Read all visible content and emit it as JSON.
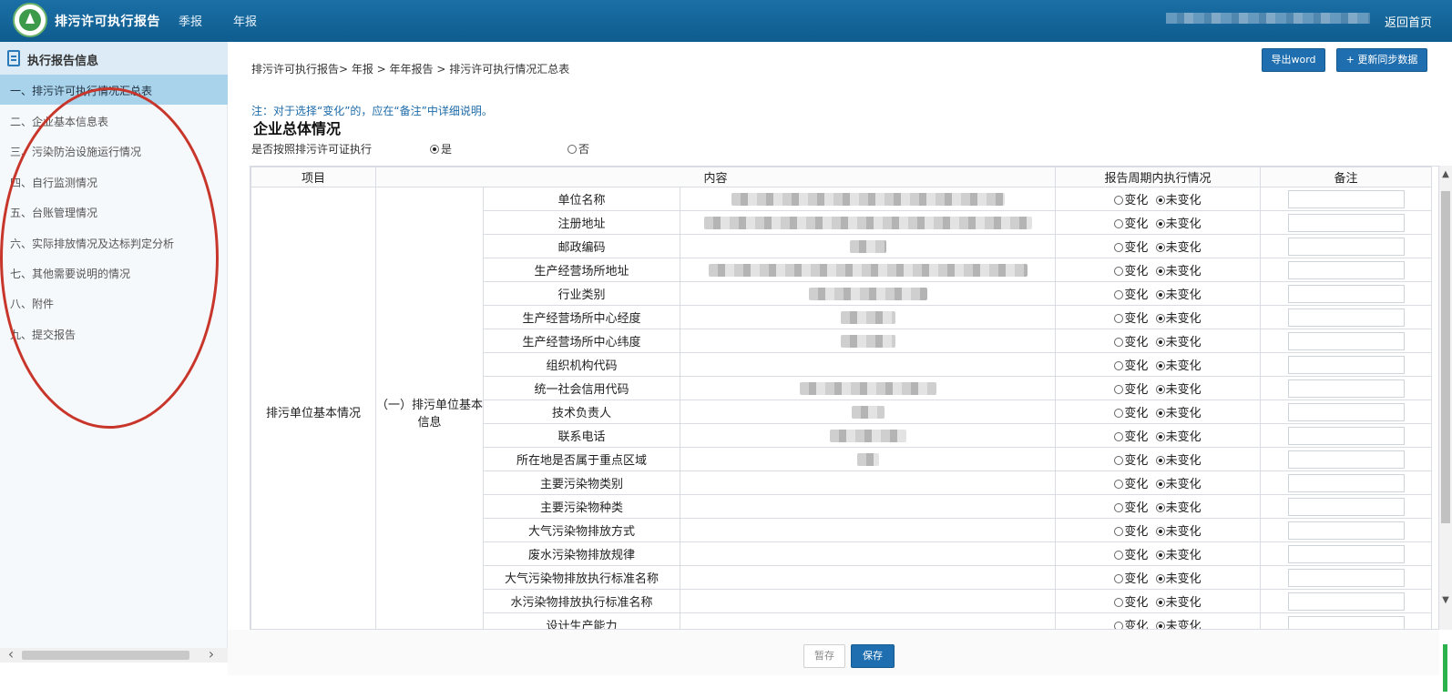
{
  "header": {
    "app_title": "排污许可执行报告",
    "nav": [
      "季报",
      "年报"
    ],
    "home": "返回首页"
  },
  "sidebar": {
    "title": "执行报告信息",
    "items": [
      "一、排污许可执行情况汇总表",
      "二、企业基本信息表",
      "三、污染防治设施运行情况",
      "四、自行监测情况",
      "五、台账管理情况",
      "六、实际排放情况及达标判定分析",
      "七、其他需要说明的情况",
      "八、附件",
      "九、提交报告"
    ],
    "active_index": 0
  },
  "main": {
    "breadcrumb": "排污许可执行报告> 年报 > 年年报告 > 排污许可执行情况汇总表",
    "buttons": {
      "export_word": "导出word",
      "sync": "+ 更新同步数据"
    },
    "note": "注：对于选择“变化”的，应在“备注”中详细说明。",
    "section_title": "企业总体情况",
    "exec_question": "是否按照排污许可证执行",
    "exec_yes": "是",
    "exec_no": "否",
    "table": {
      "headers": [
        "项目",
        "内容",
        "报告周期内执行情况",
        "备注"
      ],
      "group_level1": "排污单位基本情况",
      "group_level2": "（一）排污单位基本信息",
      "option_changed": "变化",
      "option_unchanged": "未变化",
      "rows": [
        "单位名称",
        "注册地址",
        "邮政编码",
        "生产经营场所地址",
        "行业类别",
        "生产经营场所中心经度",
        "生产经营场所中心纬度",
        "组织机构代码",
        "统一社会信用代码",
        "技术负责人",
        "联系电话",
        "所在地是否属于重点区域",
        "主要污染物类别",
        "主要污染物种类",
        "大气污染物排放方式",
        "废水污染物排放规律",
        "大气污染物排放执行标准名称",
        "水污染物排放执行标准名称",
        "设计生产能力"
      ]
    },
    "footer": {
      "draft": "暂存",
      "save": "保存"
    }
  },
  "colors": {
    "header_bg": "#1a6fa6",
    "active_item_bg": "#a8d3ea",
    "primary_button": "#1f6fb0",
    "annotation_red": "#c8362b"
  }
}
